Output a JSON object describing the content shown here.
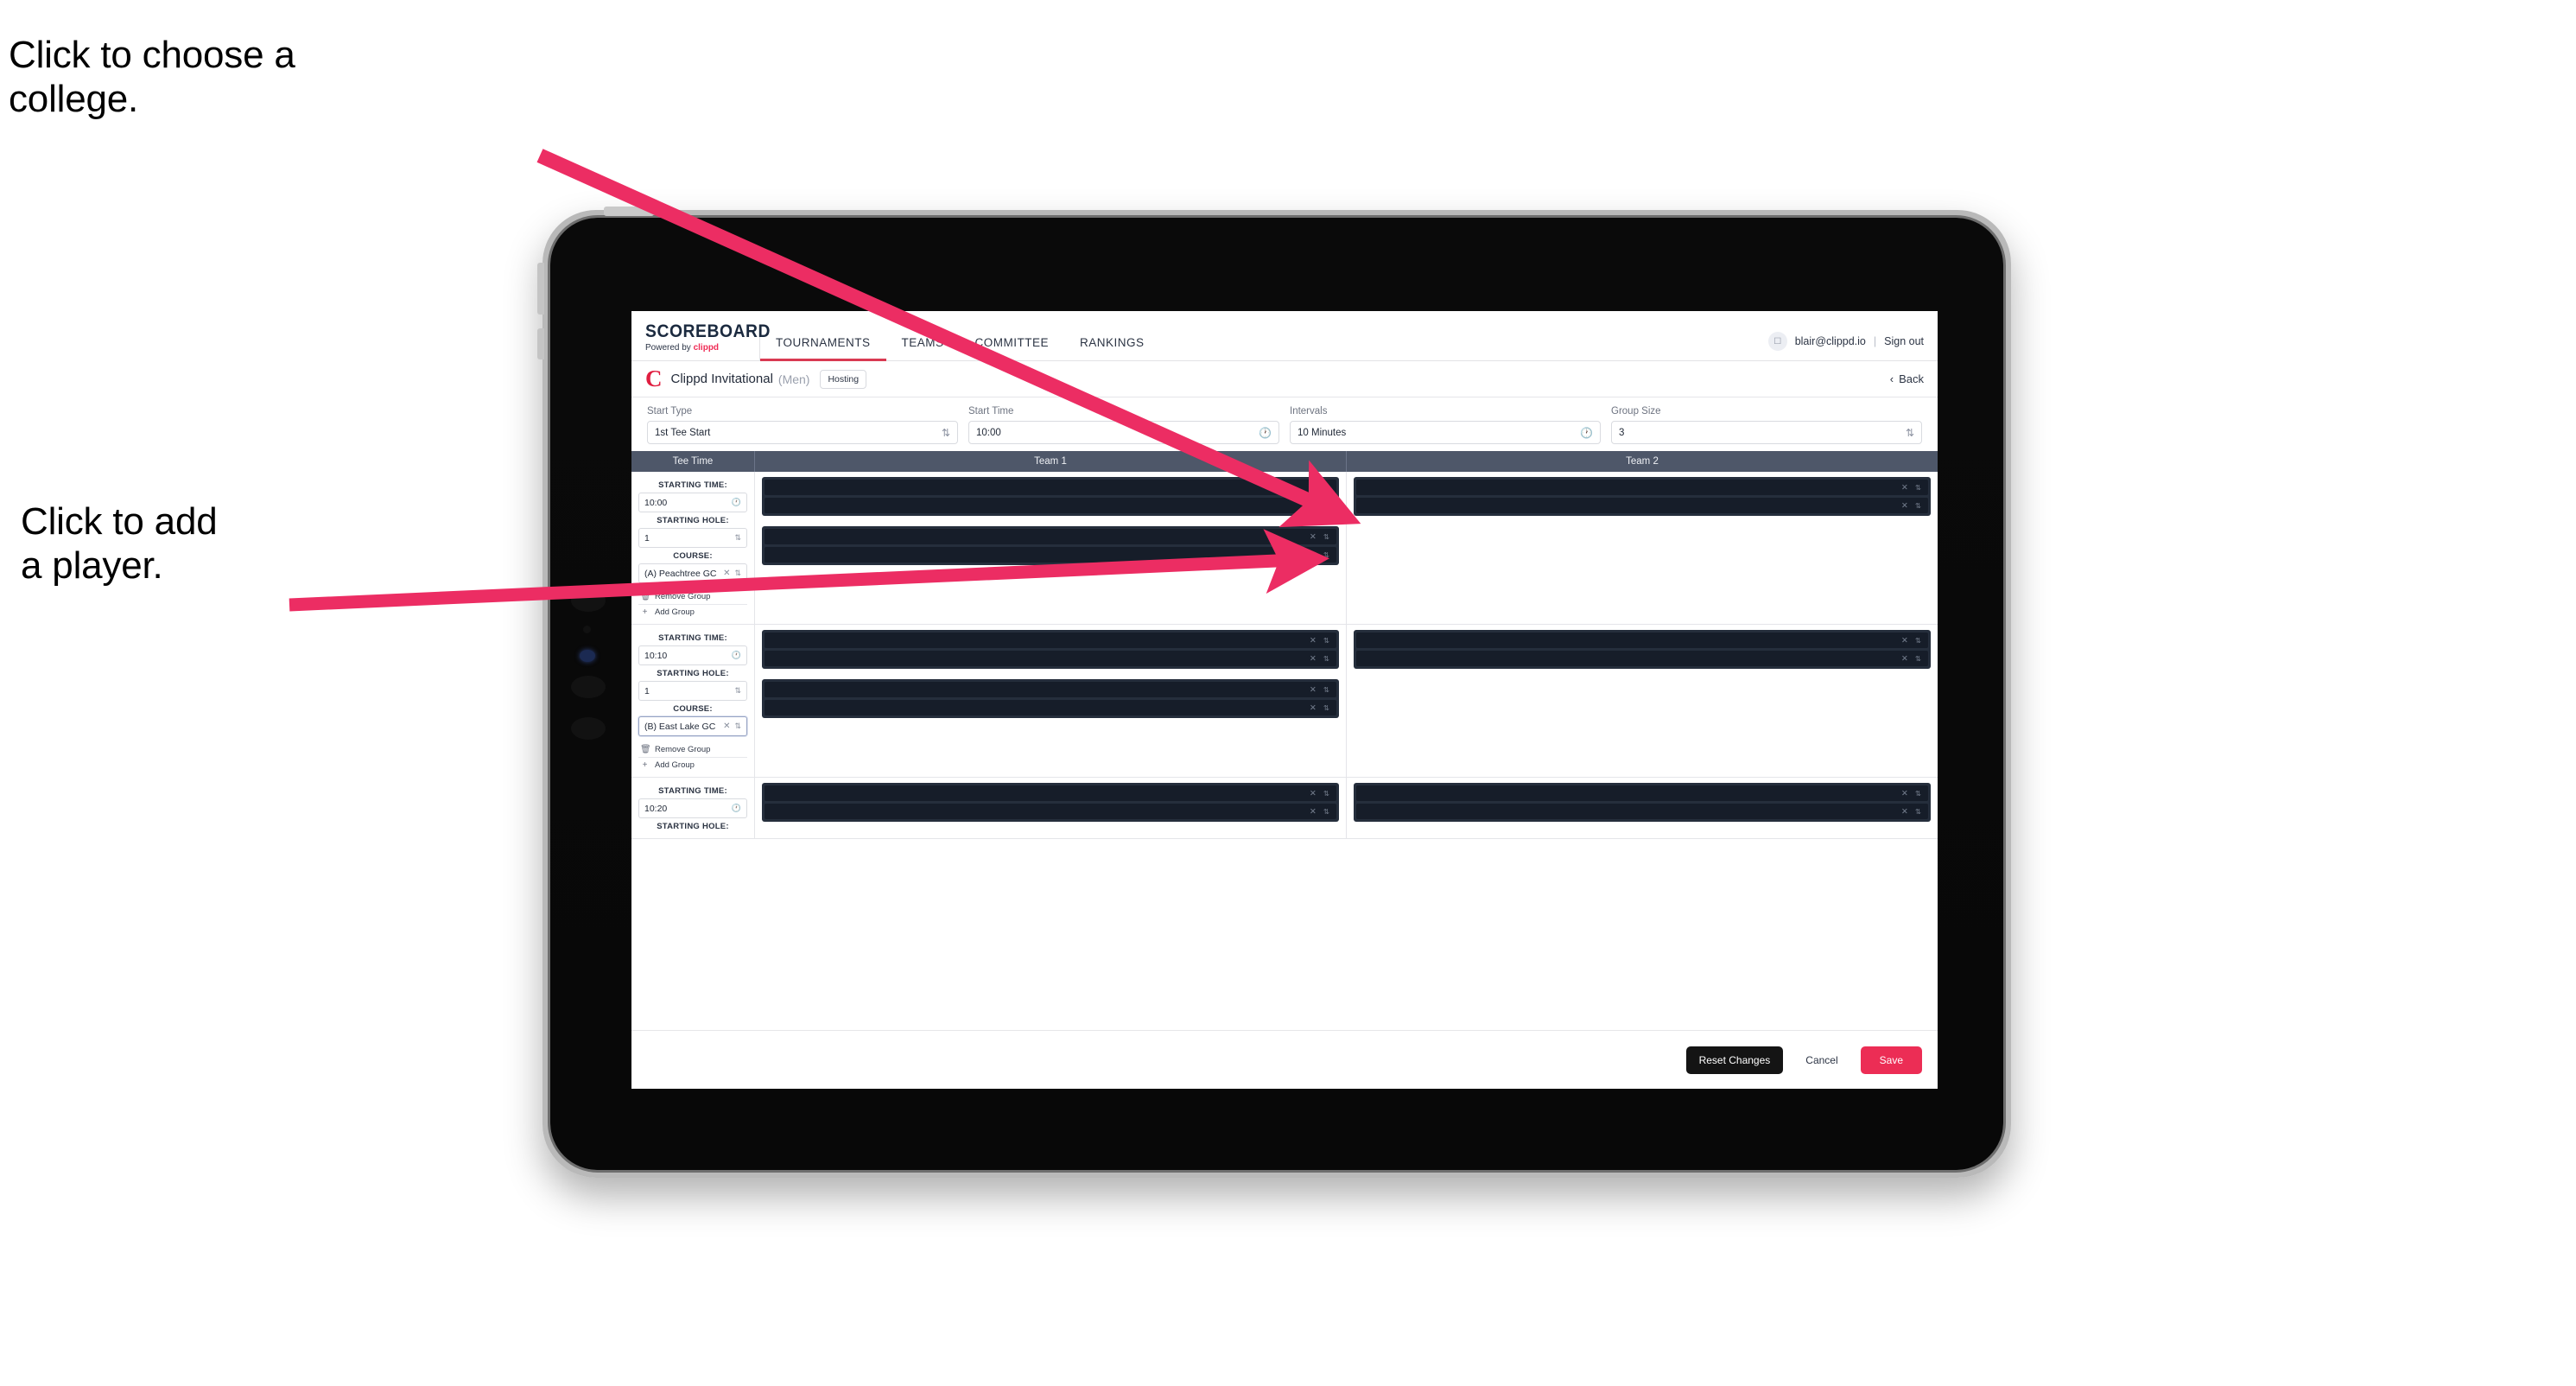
{
  "annotations": {
    "college": "Click to choose a\ncollege.",
    "player": "Click to add\na player."
  },
  "colors": {
    "accent_pink": "#ec2d55",
    "brand_red": "#e01e40",
    "table_header": "#4e5769",
    "player_card": "#252e3c",
    "player_row": "#161d29",
    "annotation_arrow": "#ec2d63"
  },
  "app": {
    "brand": {
      "main": "SCOREBOARD",
      "sub_prefix": "Powered by",
      "sub_brand": "clippd"
    },
    "nav": [
      {
        "label": "TOURNAMENTS",
        "active": true
      },
      {
        "label": "TEAMS",
        "active": false
      },
      {
        "label": "COMMITTEE",
        "active": false
      },
      {
        "label": "RANKINGS",
        "active": false
      }
    ],
    "account": {
      "avatar_icon": "user-avatar-icon",
      "email": "blair@clippd.io",
      "separator": "|",
      "sign_out": "Sign out"
    },
    "title_bar": {
      "logo": "C",
      "tournament": "Clippd Invitational",
      "gender": "(Men)",
      "badge": "Hosting",
      "back": "Back",
      "back_icon": "chevron-left-icon"
    },
    "controls": [
      {
        "label": "Start Type",
        "value": "1st Tee Start",
        "icon": "stepper-icon"
      },
      {
        "label": "Start Time",
        "value": "10:00",
        "icon": "clock-icon"
      },
      {
        "label": "Intervals",
        "value": "10 Minutes",
        "icon": "clock-icon"
      },
      {
        "label": "Group Size",
        "value": "3",
        "icon": "stepper-icon"
      }
    ],
    "table": {
      "headers": {
        "tee_time": "Tee Time",
        "team1": "Team 1",
        "team2": "Team 2"
      },
      "field_labels": {
        "starting_time": "STARTING TIME:",
        "starting_hole": "STARTING HOLE:",
        "course": "COURSE:"
      },
      "links": {
        "remove_group": "Remove Group",
        "remove_icon": "trash-icon",
        "add_group": "Add Group",
        "add_icon": "plus-icon"
      },
      "groups": [
        {
          "starting_time": "10:00",
          "starting_hole": "1",
          "course": "(A) Peachtree GC",
          "course_focused": false,
          "team1": [
            {
              "players": 2
            },
            {
              "players": 2
            }
          ],
          "team2": [
            {
              "players": 2
            }
          ]
        },
        {
          "starting_time": "10:10",
          "starting_hole": "1",
          "course": "(B) East Lake GC",
          "course_focused": true,
          "team1": [
            {
              "players": 2
            },
            {
              "players": 2
            }
          ],
          "team2": [
            {
              "players": 2
            }
          ]
        },
        {
          "starting_time": "10:20",
          "starting_hole": "",
          "course": "",
          "course_focused": false,
          "team1": [
            {
              "players": 2
            }
          ],
          "team2": [
            {
              "players": 2
            }
          ]
        }
      ],
      "row_icons": {
        "clear": "close-icon",
        "stepper": "stepper-icon"
      }
    },
    "footer": {
      "reset": "Reset Changes",
      "cancel": "Cancel",
      "save": "Save"
    }
  }
}
